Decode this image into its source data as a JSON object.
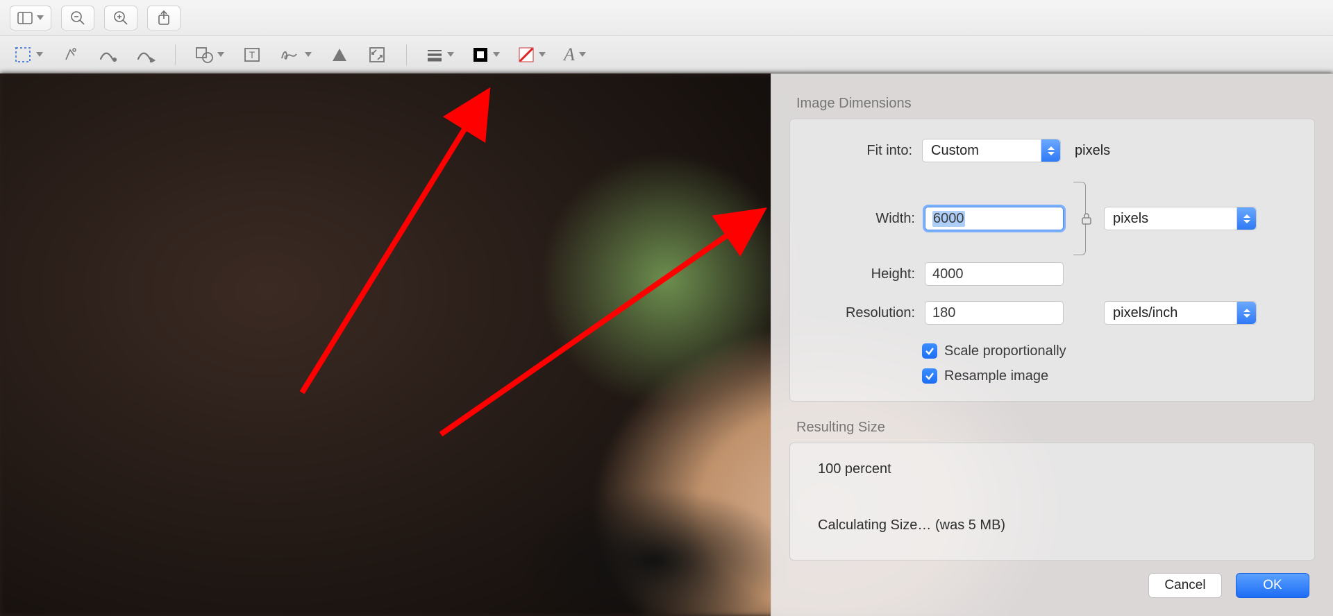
{
  "dialog": {
    "section_image_dimensions": "Image Dimensions",
    "fit_into_label": "Fit into:",
    "fit_into_value": "Custom",
    "fit_into_unit": "pixels",
    "width_label": "Width:",
    "width_value": "6000",
    "height_label": "Height:",
    "height_value": "4000",
    "size_unit_value": "pixels",
    "resolution_label": "Resolution:",
    "resolution_value": "180",
    "resolution_unit_value": "pixels/inch",
    "scale_prop_label": "Scale proportionally",
    "resample_label": "Resample image",
    "section_resulting_size": "Resulting Size",
    "result_percent": "100 percent",
    "calculating": "Calculating Size… (was 5 MB)",
    "cancel": "Cancel",
    "ok": "OK"
  }
}
